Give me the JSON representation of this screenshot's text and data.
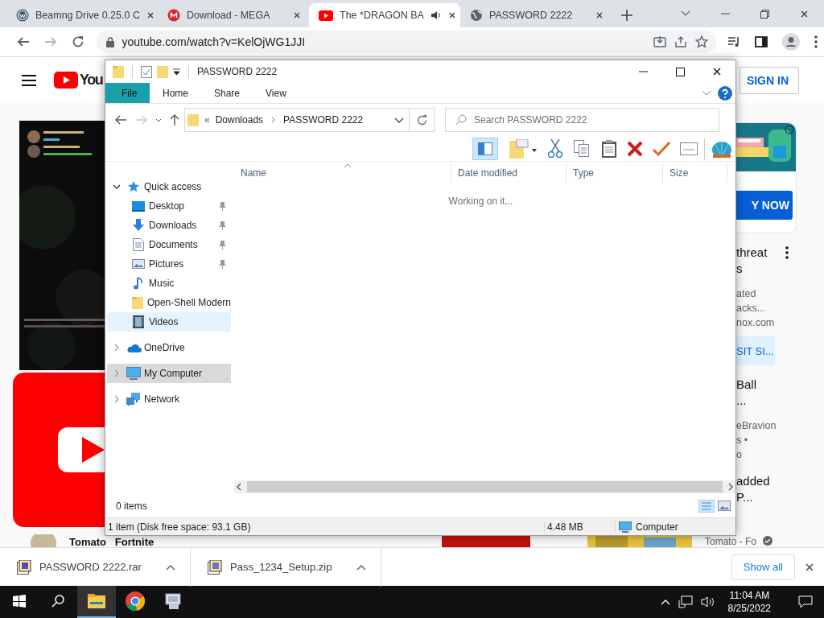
{
  "browser": {
    "tabs": [
      {
        "title": "Beamng Drive 0.25.0 C",
        "kind": "wordpress",
        "selected": false,
        "audio": false
      },
      {
        "title": "Download - MEGA",
        "kind": "mega",
        "selected": false,
        "audio": false
      },
      {
        "title": "The *DRAGON BA",
        "kind": "youtube",
        "selected": true,
        "audio": true
      },
      {
        "title": "PASSWORD 2222",
        "kind": "globe",
        "selected": false,
        "audio": false
      }
    ],
    "url": "youtube.com/watch?v=KelOjWG1JJI"
  },
  "youtube": {
    "logo": "You",
    "sign_in": "SIGN IN",
    "ad_button": "Y NOW",
    "sidebar": [
      {
        "title_lines": [
          "threat",
          "s"
        ],
        "meta_lines": [
          "ated",
          "acks...",
          "nox.com"
        ],
        "button": "SIT SI..."
      },
      {
        "title_lines": [
          "Ball",
          "..."
        ],
        "meta_lines": [
          "eBravion",
          "s •",
          "o"
        ]
      },
      {
        "title_lines": [
          "added",
          "P..."
        ]
      }
    ],
    "bottom_channel": "Tomato   Fortnite",
    "bottom_right": "Tomato - Fo"
  },
  "explorer": {
    "title": "PASSWORD 2222",
    "ribbon_tabs": [
      {
        "label": "File",
        "selected": true
      },
      {
        "label": "Home",
        "selected": false
      },
      {
        "label": "Share",
        "selected": false
      },
      {
        "label": "View",
        "selected": false
      }
    ],
    "breadcrumb_overflow": "«",
    "path": [
      "Downloads",
      "PASSWORD 2222"
    ],
    "search_placeholder": "Search PASSWORD 2222",
    "pane_toggle_on": true,
    "nav": [
      {
        "label": "Quick access",
        "kind": "star",
        "expanded": true,
        "selected": false,
        "highlighted": false,
        "children": [
          {
            "label": "Desktop",
            "kind": "desktop",
            "pinned": true,
            "selected": false,
            "highlighted": false
          },
          {
            "label": "Downloads",
            "kind": "download",
            "pinned": true,
            "selected": false,
            "highlighted": false
          },
          {
            "label": "Documents",
            "kind": "document",
            "pinned": true,
            "selected": false,
            "highlighted": false
          },
          {
            "label": "Pictures",
            "kind": "picture",
            "pinned": true,
            "selected": false,
            "highlighted": false
          },
          {
            "label": "Music",
            "kind": "music",
            "pinned": false,
            "selected": false,
            "highlighted": false
          },
          {
            "label": "Open-Shell Modern",
            "kind": "folder",
            "pinned": false,
            "selected": false,
            "highlighted": false
          },
          {
            "label": "Videos",
            "kind": "video",
            "pinned": false,
            "selected": false,
            "highlighted": true
          }
        ]
      },
      {
        "label": "OneDrive",
        "kind": "cloud",
        "expanded": false,
        "selected": false,
        "highlighted": false
      },
      {
        "label": "My Computer",
        "kind": "computer",
        "expanded": false,
        "selected": true,
        "highlighted": false
      },
      {
        "label": "Network",
        "kind": "network",
        "expanded": false,
        "selected": false,
        "highlighted": false
      }
    ],
    "columns": [
      "Name",
      "Date modified",
      "Type",
      "Size"
    ],
    "status_message": "Working on it...",
    "item_count": "0 items",
    "status_bar": [
      "1 item (Disk free space: 93.1 GB)",
      "4.48 MB",
      "Computer"
    ]
  },
  "downloads": {
    "items": [
      {
        "name": "PASSWORD 2222.rar",
        "kind": "rar"
      },
      {
        "name": "Pass_1234_Setup.zip",
        "kind": "zip"
      }
    ],
    "show_all": "Show all"
  },
  "taskbar": {
    "apps": [
      {
        "kind": "explorer",
        "selected": true
      },
      {
        "kind": "chrome",
        "selected": false
      },
      {
        "kind": "app",
        "selected": false
      }
    ],
    "time": "11:04 AM",
    "date": "8/25/2022"
  }
}
